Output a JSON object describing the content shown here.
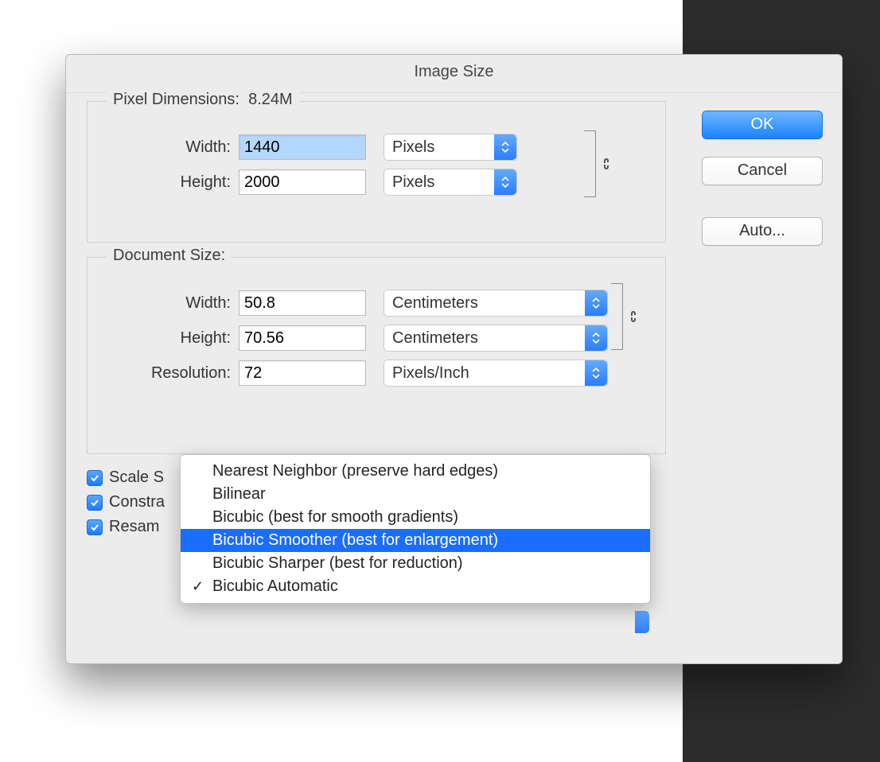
{
  "dialog": {
    "title": "Image Size",
    "buttons": {
      "ok": "OK",
      "cancel": "Cancel",
      "auto": "Auto..."
    }
  },
  "pixel_dimensions": {
    "legend_label": "Pixel Dimensions:",
    "legend_size": "8.24M",
    "width_label": "Width:",
    "width_value": "1440",
    "width_unit": "Pixels",
    "height_label": "Height:",
    "height_value": "2000",
    "height_unit": "Pixels"
  },
  "document_size": {
    "legend": "Document Size:",
    "width_label": "Width:",
    "width_value": "50.8",
    "width_unit": "Centimeters",
    "height_label": "Height:",
    "height_value": "70.56",
    "height_unit": "Centimeters",
    "resolution_label": "Resolution:",
    "resolution_value": "72",
    "resolution_unit": "Pixels/Inch"
  },
  "checks": {
    "scale_styles": "Scale Styles",
    "constrain": "Constrain Proportions",
    "resample": "Resample Image:",
    "scale_styles_visible": "Scale S",
    "constrain_visible": "Constra",
    "resample_visible": "Resam"
  },
  "resample_menu": {
    "items": [
      "Nearest Neighbor (preserve hard edges)",
      "Bilinear",
      "Bicubic (best for smooth gradients)",
      "Bicubic Smoother (best for enlargement)",
      "Bicubic Sharper (best for reduction)",
      "Bicubic Automatic"
    ],
    "highlighted_index": 3,
    "checked_index": 5
  }
}
